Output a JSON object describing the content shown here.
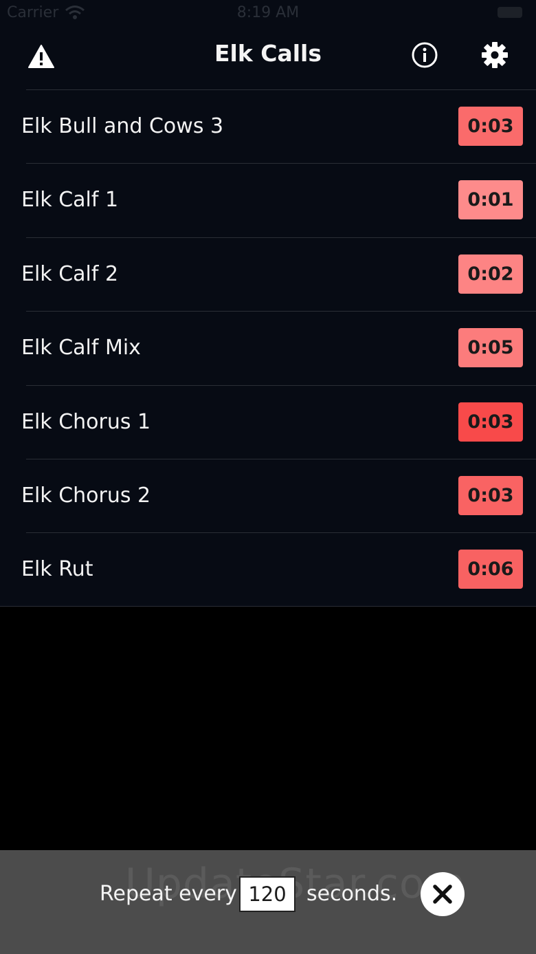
{
  "status_bar": {
    "carrier": "Carrier",
    "time": "8:19 AM"
  },
  "nav": {
    "title": "Elk Calls",
    "left_icon": "warning-icon",
    "right_icons": [
      "info-icon",
      "gear-icon"
    ]
  },
  "calls": [
    {
      "name": "Elk Bull and Cows 3",
      "duration": "0:03",
      "badge_color": "#fa6b6b"
    },
    {
      "name": "Elk Calf 1",
      "duration": "0:01",
      "badge_color": "#fd8b8b"
    },
    {
      "name": "Elk Calf 2",
      "duration": "0:02",
      "badge_color": "#fd8484"
    },
    {
      "name": "Elk Calf Mix",
      "duration": "0:05",
      "badge_color": "#fc7c7c"
    },
    {
      "name": "Elk Chorus 1",
      "duration": "0:03",
      "badge_color": "#f84a4a"
    },
    {
      "name": "Elk Chorus 2",
      "duration": "0:03",
      "badge_color": "#f96363"
    },
    {
      "name": "Elk Rut",
      "duration": "0:06",
      "badge_color": "#f86262"
    }
  ],
  "repeat": {
    "prefix": "Repeat every",
    "value": "120",
    "suffix": "seconds.",
    "close_icon": "close-icon"
  },
  "watermark": "UpdateStar.com"
}
